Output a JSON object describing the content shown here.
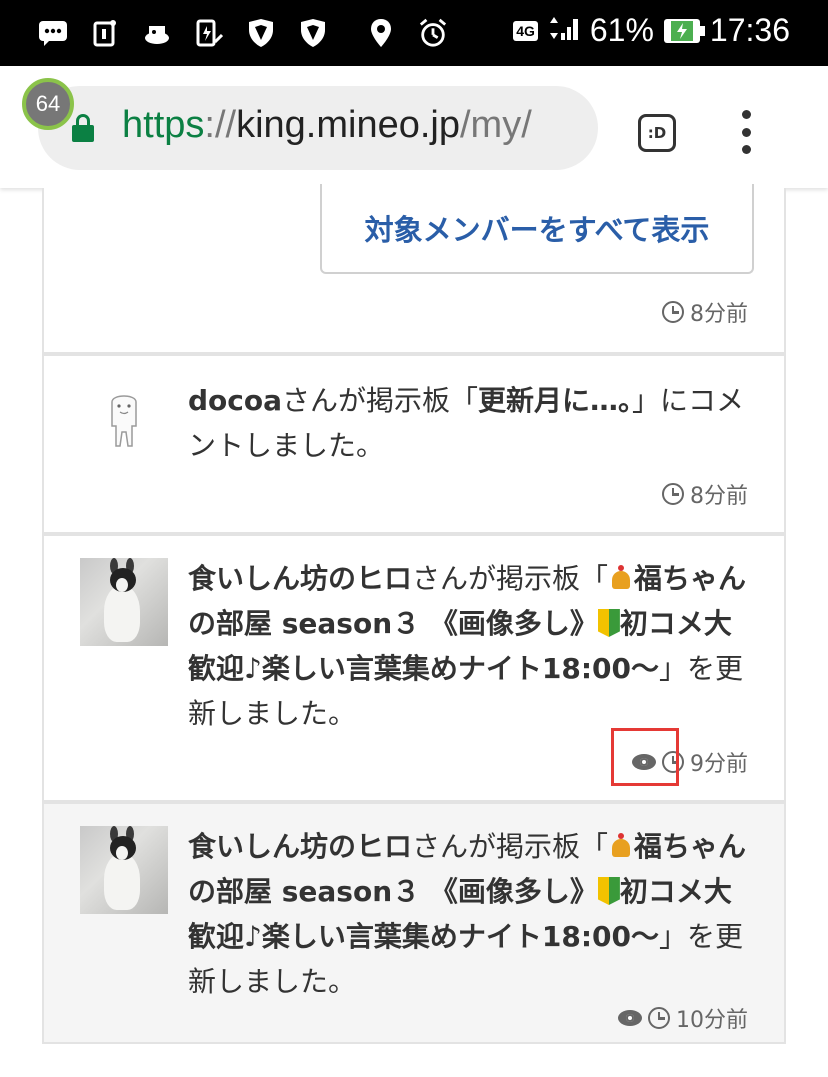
{
  "status_bar": {
    "network": "4G",
    "battery": "61%",
    "time": "17:36",
    "icons": [
      "message-icon",
      "notification-icon",
      "app-icon",
      "battery-saver-icon",
      "vpn-shield-icon",
      "vpn-shield-icon",
      "location-icon",
      "alarm-icon"
    ]
  },
  "browser": {
    "tab_count": "64",
    "url": {
      "scheme": "https",
      "sep": "://",
      "host": "king.mineo.jp",
      "path": "/my/"
    },
    "tab_button": ":D"
  },
  "feed": {
    "show_all_members": "対象メンバーをすべて表示",
    "items": [
      {
        "time": "8分前"
      },
      {
        "user": "docoa",
        "text_a": "さんが掲示板「",
        "board": "更新月に…。",
        "text_b": "」にコメントしました。",
        "time": "8分前"
      },
      {
        "user": "食いしん坊のヒロ",
        "text_a": "さんが掲示板「",
        "board_a": "福ちゃんの部屋 season３ 《画像多し》",
        "board_b": "初コメ大歓迎♪楽しい言葉集めナイト18:00〜",
        "text_b": "」を更新しました。",
        "time": "9分前"
      },
      {
        "user": "食いしん坊のヒロ",
        "text_a": "さんが掲示板「",
        "board_a": "福ちゃんの部屋 season３ 《画像多し》",
        "board_b": "初コメ大歓迎♪楽しい言葉集めナイト18:00〜",
        "text_b": "」を更新しました。",
        "time": "10分前"
      }
    ]
  },
  "colors": {
    "link_blue": "#2a5ea8",
    "secure_green": "#0b8043",
    "highlight_red": "#e53935",
    "read_background": "#f5f5f5"
  }
}
